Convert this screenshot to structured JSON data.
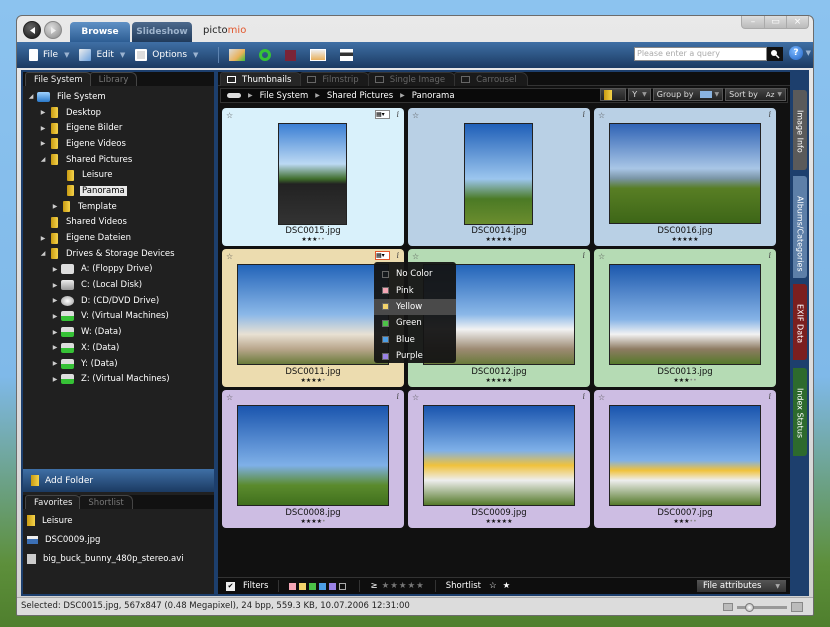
{
  "window": {
    "tabs": [
      {
        "label": "Browse",
        "active": true
      },
      {
        "label": "Slideshow",
        "active": false
      }
    ],
    "logo": {
      "prefix": "picto",
      "suffix": "mio"
    },
    "controls": [
      "minimize",
      "maximize",
      "close"
    ]
  },
  "toolbar": {
    "file_label": "File",
    "edit_label": "Edit",
    "options_label": "Options",
    "icons": [
      "import-icon",
      "rotate-icon",
      "stop-icon",
      "slideshow-icon",
      "print-icon"
    ],
    "search_placeholder": "Please enter a query",
    "help_label": "?"
  },
  "left_panel": {
    "tabs": [
      {
        "label": "File System",
        "active": true
      },
      {
        "label": "Library",
        "active": false
      }
    ],
    "tree": [
      {
        "label": "File System",
        "level": 0,
        "expander": "open",
        "icon": "computer"
      },
      {
        "label": "Desktop",
        "level": 1,
        "expander": "closed",
        "icon": "folder"
      },
      {
        "label": "Eigene Bilder",
        "level": 1,
        "expander": "closed",
        "icon": "folder"
      },
      {
        "label": "Eigene Videos",
        "level": 1,
        "expander": "closed",
        "icon": "folder"
      },
      {
        "label": "Shared Pictures",
        "level": 1,
        "expander": "open",
        "icon": "folder"
      },
      {
        "label": "Leisure",
        "level": 2,
        "expander": "none",
        "icon": "folder"
      },
      {
        "label": "Panorama",
        "level": 2,
        "expander": "none",
        "icon": "folder",
        "selected": true
      },
      {
        "label": "Template",
        "level": 2,
        "expander": "closed",
        "icon": "folder"
      },
      {
        "label": "Shared Videos",
        "level": 1,
        "expander": "none",
        "icon": "folder"
      },
      {
        "label": "Eigene Dateien",
        "level": 1,
        "expander": "closed",
        "icon": "folder"
      },
      {
        "label": "Drives & Storage Devices",
        "level": 1,
        "expander": "open",
        "icon": "folder"
      },
      {
        "label": "A: (Floppy Drive)",
        "level": 2,
        "expander": "closed",
        "icon": "floppy"
      },
      {
        "label": "C: (Local Disk)",
        "level": 2,
        "expander": "closed",
        "icon": "disk"
      },
      {
        "label": "D: (CD/DVD Drive)",
        "level": 2,
        "expander": "closed",
        "icon": "cd"
      },
      {
        "label": "V: (Virtual Machines)",
        "level": 2,
        "expander": "closed",
        "icon": "network"
      },
      {
        "label": "W: (Data)",
        "level": 2,
        "expander": "closed",
        "icon": "network"
      },
      {
        "label": "X: (Data)",
        "level": 2,
        "expander": "closed",
        "icon": "network"
      },
      {
        "label": "Y: (Data)",
        "level": 2,
        "expander": "closed",
        "icon": "network"
      },
      {
        "label": "Z: (Virtual Machines)",
        "level": 2,
        "expander": "closed",
        "icon": "network"
      }
    ],
    "add_folder_label": "Add Folder",
    "bottom_tabs": [
      {
        "label": "Favorites",
        "active": true
      },
      {
        "label": "Shortlist",
        "active": false
      }
    ],
    "favorites": [
      {
        "label": "Leisure",
        "icon": "folder"
      },
      {
        "label": "DSC0009.jpg",
        "icon": "image"
      },
      {
        "label": "big_buck_bunny_480p_stereo.avi",
        "icon": "video"
      }
    ]
  },
  "main": {
    "view_tabs": [
      {
        "label": "Thumbnails",
        "active": true
      },
      {
        "label": "Filmstrip",
        "active": false
      },
      {
        "label": "Single Image",
        "active": false
      },
      {
        "label": "Carrousel",
        "active": false
      }
    ],
    "breadcrumb": [
      "File System",
      "Shared Pictures",
      "Panorama"
    ],
    "group_by_label": "Group by",
    "sort_by_label": "Sort by",
    "sort_icon_label": "Az",
    "thumbnails": [
      {
        "filename": "DSC0015.jpg",
        "rating": 3,
        "color": "#d9f1fb",
        "orientation": "portrait",
        "selected": true
      },
      {
        "filename": "DSC0014.jpg",
        "rating": 5,
        "color": "#b9d0e5",
        "orientation": "portrait"
      },
      {
        "filename": "DSC0016.jpg",
        "rating": 5,
        "color": "#b9d0e5",
        "orientation": "landscape"
      },
      {
        "filename": "DSC0011.jpg",
        "rating": 4,
        "color": "#ecdcaf",
        "orientation": "landscape"
      },
      {
        "filename": "DSC0012.jpg",
        "rating": 5,
        "color": "#b5dbb4",
        "orientation": "landscape"
      },
      {
        "filename": "DSC0013.jpg",
        "rating": 3,
        "color": "#b5dbb4",
        "orientation": "landscape"
      },
      {
        "filename": "DSC0008.jpg",
        "rating": 4,
        "color": "#cdbde3",
        "orientation": "landscape"
      },
      {
        "filename": "DSC0009.jpg",
        "rating": 5,
        "color": "#cdbde3",
        "orientation": "landscape"
      },
      {
        "filename": "DSC0007.jpg",
        "rating": 3,
        "color": "#cdbde3",
        "orientation": "landscape"
      }
    ],
    "color_menu": [
      {
        "label": "No Color",
        "swatch": "transparent"
      },
      {
        "label": "Pink",
        "swatch": "#f4a6b5"
      },
      {
        "label": "Yellow",
        "swatch": "#f3d36b",
        "highlighted": true
      },
      {
        "label": "Green",
        "swatch": "#4cc247"
      },
      {
        "label": "Blue",
        "swatch": "#4c9ee6"
      },
      {
        "label": "Purple",
        "swatch": "#9a82e6"
      }
    ],
    "bottom_bar": {
      "filters_label": "Filters",
      "filters_checked": true,
      "filter_colors": [
        "#f4a6b5",
        "#f3d36b",
        "#4cc247",
        "#4c9ee6",
        "#9a82e6",
        "transparent"
      ],
      "rating_prefix": "≥",
      "rating_stars": 5,
      "shortlist_label": "Shortlist",
      "file_attributes_label": "File attributes"
    }
  },
  "side_tabs": [
    {
      "label": "Image Info",
      "color": "#5a5a5a"
    },
    {
      "label": "Albums/Categories",
      "color": "#5d7fa8"
    },
    {
      "label": "EXIF Data",
      "color": "#7b1f1f"
    },
    {
      "label": "Index Status",
      "color": "#2d6a2d"
    }
  ],
  "status_bar": {
    "text": "Selected: DSC0015.jpg, 567x847 (0.48 Megapixel), 24 bpp, 559.3 KB, 10.07.2006 12:31:00",
    "zoom_level": 0.2
  }
}
